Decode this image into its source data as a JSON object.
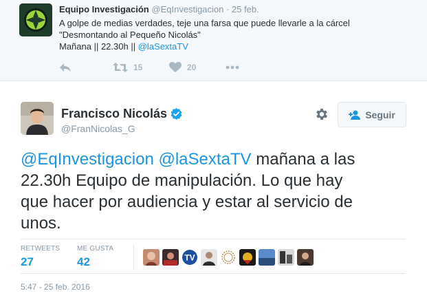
{
  "parent_tweet": {
    "name": "Equipo Investigación",
    "handle": "@EqInvestigacion",
    "separator": "·",
    "time": "25 feb.",
    "text_line1": "A golpe de medias verdades, teje una farsa que puede llevarle a la cárcel",
    "text_line2": "\"Desmontando al Pequeño Nicolás\"",
    "text_line3_prefix": "Mañana || 22.30h || ",
    "text_line3_link": "@laSextaTV",
    "retweet_count": "15",
    "like_count": "20",
    "icons": [
      "reply-icon",
      "retweet-icon",
      "heart-icon",
      "more-icon"
    ],
    "avatar_colors": {
      "bg": "#1f3b2a",
      "ring": "#9bd53a"
    }
  },
  "main_tweet": {
    "name": "Francisco Nicolás",
    "handle": "@FranNicolas_G",
    "follow_label": "Seguir",
    "text_line1_link1": "@EqInvestigacion",
    "text_line1_link2": "@laSextaTV",
    "text_line1_rest": " mañana a las",
    "text_line2": "22.30h Equipo de manipulación. Lo que hay",
    "text_line3": "que hacer por audiencia y estar al servicio de",
    "text_line4": "unos.",
    "retweets_label": "RETWEETS",
    "retweets_value": "27",
    "likes_label": "ME GUSTA",
    "likes_value": "42",
    "timestamp": "5:47 - 25 feb. 2016",
    "liker_avatar_count": 9,
    "colors": {
      "link": "#1b95e0",
      "verified": "#1da1f2",
      "text": "#292f33",
      "muted": "#8899a6"
    }
  }
}
